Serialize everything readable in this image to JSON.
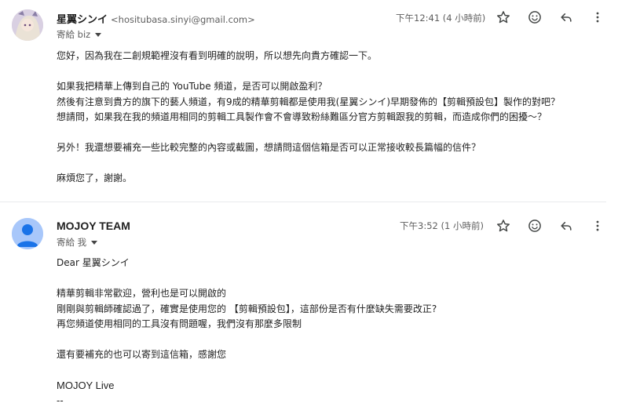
{
  "messages": [
    {
      "sender_name": "星翼シンイ",
      "sender_email": "<hositubasa.sinyi@gmail.com>",
      "recipient_label": "寄給 biz",
      "time": "下午12:41 (4 小時前)",
      "icons": [
        "star-icon",
        "emoji-icon",
        "reply-icon",
        "more-vert-icon"
      ],
      "body": {
        "p1": "您好，因為我在二創規範裡沒有看到明確的說明，所以想先向貴方確認一下。",
        "p2a": "如果我把精華上傳到自己的 YouTube 頻道，是否可以開啟盈利？",
        "p2b": "然後有注意到貴方的旗下的藝人頻道，有9成的精華剪輯都是使用我(星翼シンイ)早期發佈的【剪輯預設包】製作的對吧？",
        "p2c": "想請問，如果我在我的頻道用相同的剪輯工具製作會不會導致粉絲難區分官方剪輯跟我的剪輯，而造成你們的困擾～？",
        "p3": "另外！我還想要補充一些比較完整的內容或截圖，想請問這個信箱是否可以正常接收較長篇幅的信件？",
        "p4": "麻煩您了，謝謝。"
      }
    },
    {
      "sender_name": "MOJOY TEAM",
      "recipient_label": "寄給 我",
      "time": "下午3:52 (1 小時前)",
      "icons": [
        "star-icon",
        "emoji-icon",
        "reply-icon",
        "more-vert-icon"
      ],
      "body": {
        "greeting": "Dear 星翼シンイ",
        "p1a": "精華剪輯非常歡迎，營利也是可以開啟的",
        "p1b": "剛剛與剪輯師確認過了，確實是使用您的 【剪輯預設包】，這部份是否有什麼缺失需要改正?",
        "p1c": "再您頻道使用相同的工具沒有問題喔，我們沒有那麼多限制",
        "p2": "還有要補充的也可以寄到這信箱，感謝您",
        "signature": "MOJOY Live",
        "sig_sep": "--"
      }
    }
  ],
  "colors": {
    "avatar_default_bg": "#a8c7fa",
    "avatar_default_fg": "#1a73e8",
    "icon": "#444746",
    "secondary_text": "#5e5e5e"
  }
}
